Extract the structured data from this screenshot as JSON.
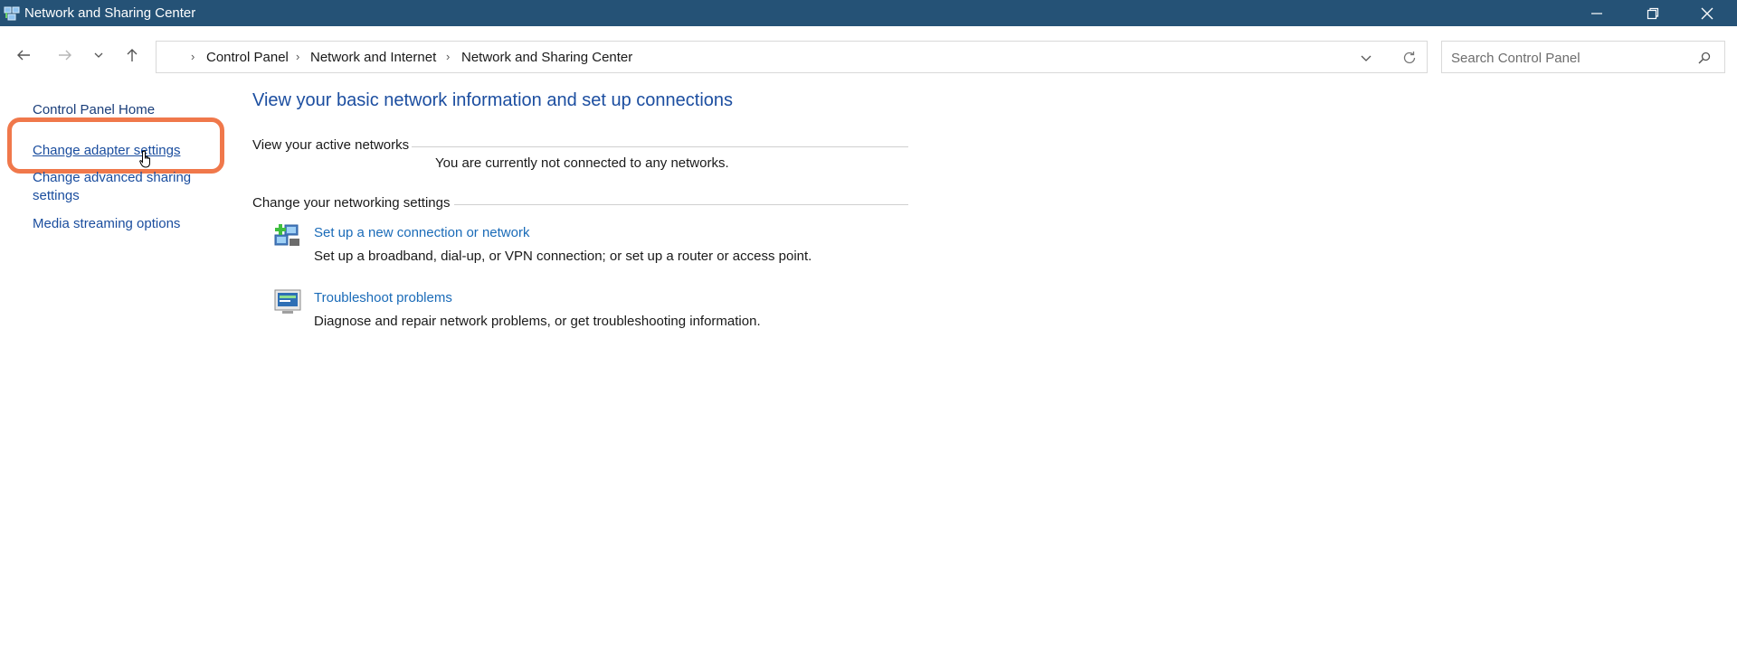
{
  "window": {
    "title": "Network and Sharing Center"
  },
  "address_bar": {
    "breadcrumb": [
      "Control Panel",
      "Network and Internet",
      "Network and Sharing Center"
    ]
  },
  "search": {
    "placeholder": "Search Control Panel"
  },
  "left_pane": {
    "items": [
      {
        "label": "Control Panel Home"
      },
      {
        "label": "Change adapter settings"
      },
      {
        "label_line1": "Change advanced sharing",
        "label_line2": "settings"
      },
      {
        "label": "Media streaming options"
      }
    ]
  },
  "main": {
    "title": "View your basic network information and set up connections",
    "active_networks": {
      "label": "View your active networks",
      "status": "You are currently not connected to any networks."
    },
    "networking_settings": {
      "label": "Change your networking settings",
      "tasks": [
        {
          "icon": "network-setup-icon",
          "link": "Set up a new connection or network",
          "description": "Set up a broadband, dial-up, or VPN connection; or set up a router or access point."
        },
        {
          "icon": "troubleshoot-icon",
          "link": "Troubleshoot problems",
          "description": "Diagnose and repair network problems, or get troubleshooting information."
        }
      ]
    }
  },
  "colors": {
    "titlebar": "#255276",
    "link": "#1a6bb8",
    "heading": "#1c4ea0",
    "highlight": "#f0784b"
  }
}
